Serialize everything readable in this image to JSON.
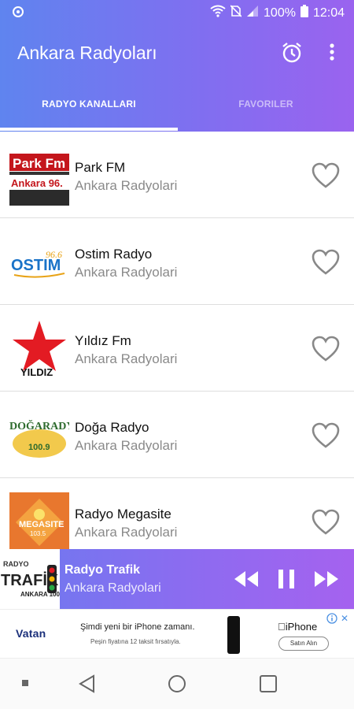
{
  "status_bar": {
    "battery": "100%",
    "time": "12:04",
    "icons": [
      "android-debug-icon",
      "wifi-icon",
      "no-sim-icon",
      "signal-icon",
      "battery-icon"
    ]
  },
  "app_bar": {
    "title": "Ankara Radyoları",
    "actions": [
      "alarm-clock-icon",
      "more-vert-icon"
    ],
    "color_start": "#5f84ef",
    "color_end": "#9a63ef"
  },
  "tabs": [
    {
      "label": "RADYO KANALLARI",
      "active": true
    },
    {
      "label": "FAVORILER",
      "active": false
    }
  ],
  "stations": [
    {
      "title": "Park FM",
      "subtitle": "Ankara Radyolari",
      "logo": "park-fm-logo",
      "logo_text": "Park Fm",
      "logo_text2": "Ankara 96."
    },
    {
      "title": "Ostim Radyo",
      "subtitle": "Ankara Radyolari",
      "logo": "ostim-radyo-logo",
      "logo_text": "OSTIM",
      "logo_text2": "96.6"
    },
    {
      "title": "Yıldız Fm",
      "subtitle": "Ankara Radyolari",
      "logo": "yildiz-fm-logo",
      "logo_text": "YILDIZ"
    },
    {
      "title": "Doğa Radyo",
      "subtitle": "Ankara Radyolari",
      "logo": "doga-radyo-logo",
      "logo_text": "DOĞARADYO",
      "logo_text2": "100.9"
    },
    {
      "title": "Radyo Megasite",
      "subtitle": "Ankara Radyolari",
      "logo": "radyo-megasite-logo",
      "logo_text": "MEGASITE",
      "logo_text2": "103.5"
    }
  ],
  "player": {
    "title": "Radyo Trafik",
    "subtitle": "Ankara Radyolari",
    "logo_text": "TRAFİK",
    "logo_text_top": "RADYO",
    "logo_text_bottom": "ANKARA 100",
    "controls": [
      "rewind-icon",
      "pause-icon",
      "fast-forward-icon"
    ]
  },
  "ad": {
    "brand": "Vatan",
    "line1": "Şimdi yeni bir iPhone zamanı.",
    "line2": "Peşin fiyatına 12 taksit fırsatıyla.",
    "product": "iPhone",
    "cta": "Satın Alın"
  },
  "nav_bar": {
    "icons": [
      "nav-dot-icon",
      "back-icon",
      "home-icon",
      "recent-apps-icon"
    ]
  }
}
